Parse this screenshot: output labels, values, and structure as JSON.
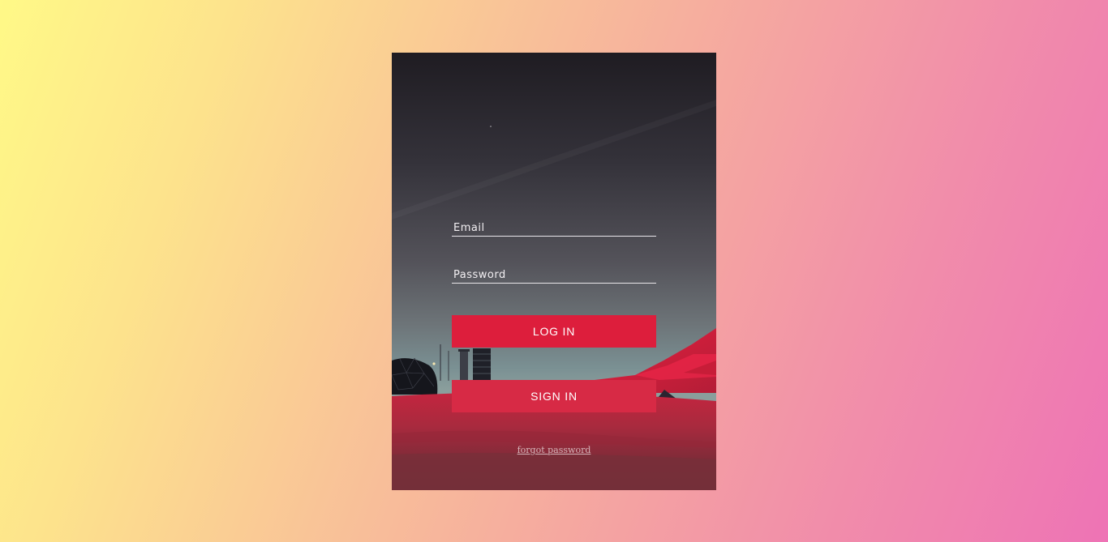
{
  "login": {
    "email_placeholder": "Email",
    "password_placeholder": "Password",
    "login_label": "LOG IN",
    "signin_label": "SIGN IN",
    "forgot_label": "forgot password"
  },
  "colors": {
    "page_gradient_start": "#fff987",
    "page_gradient_end": "#ee73b5",
    "button_primary": "#dd1e3c",
    "button_secondary": "#d72a45",
    "ground_red": "#c42a45"
  }
}
